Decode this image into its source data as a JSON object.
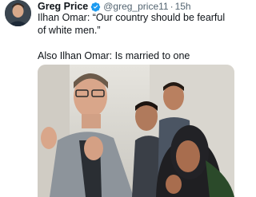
{
  "tweet": {
    "author_name": "Greg Price",
    "handle": "@greg_price11",
    "separator": "·",
    "time": "15h",
    "text_line1": "Ilhan Omar: “Our country should be fearful of white men.”",
    "text_line2": "Also Ilhan Omar: Is married to one"
  },
  "colors": {
    "verified": "#1d9bf0",
    "text": "#0f1419",
    "secondary": "#536471"
  },
  "icons": {
    "verified": "verified-badge-icon"
  }
}
